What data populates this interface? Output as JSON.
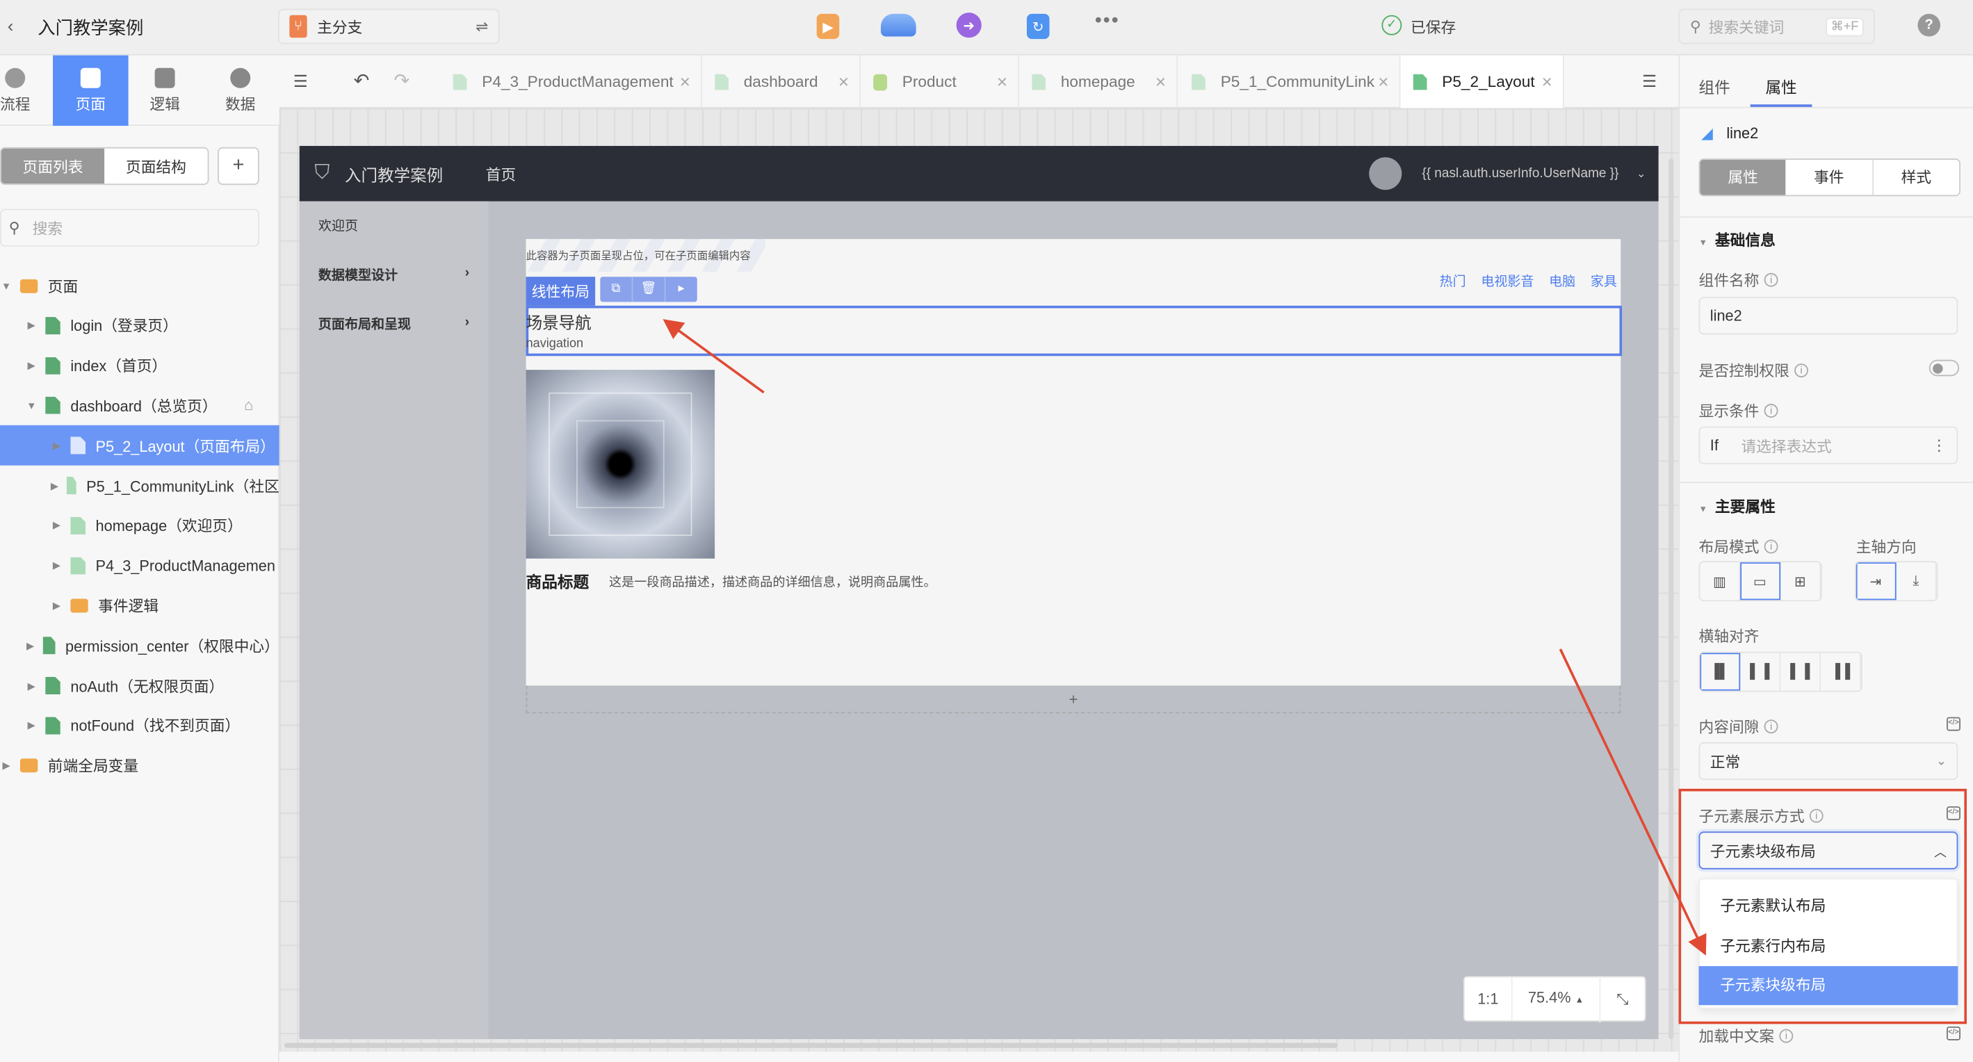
{
  "topbar": {
    "back_icon": "chevron-left-icon",
    "app_title": "入门教学案例",
    "branch": "主分支",
    "branch_switch_icon": "swap-icon",
    "tools": [
      "play-icon",
      "cloud-icon",
      "publish-icon",
      "sync-icon",
      "more-icon"
    ],
    "saved_status": "已保存",
    "search_placeholder": "搜索关键词",
    "search_shortcut": "⌘+F",
    "help_icon": "help-icon"
  },
  "strip": [
    {
      "label": "流程",
      "icon": "flow-icon"
    },
    {
      "label": "页面",
      "icon": "page-icon",
      "active": true
    },
    {
      "label": "逻辑",
      "icon": "chip-icon"
    },
    {
      "label": "数据",
      "icon": "pie-icon"
    }
  ],
  "leftpanel": {
    "seg": [
      "页面列表",
      "页面结构"
    ],
    "add": "+",
    "search_placeholder": "搜索",
    "tree": [
      {
        "label": "页面",
        "type": "folder",
        "depth": 0,
        "expanded": true
      },
      {
        "label": "login（登录页）",
        "type": "page",
        "depth": 1
      },
      {
        "label": "index（首页）",
        "type": "page",
        "depth": 1
      },
      {
        "label": "dashboard（总览页）",
        "type": "page",
        "depth": 1,
        "expanded": true,
        "home": true
      },
      {
        "label": "P5_2_Layout（页面布局）",
        "type": "subpage",
        "depth": 2,
        "selected": true
      },
      {
        "label": "P5_1_CommunityLink（社区",
        "type": "subpage",
        "depth": 2
      },
      {
        "label": "homepage（欢迎页）",
        "type": "subpage",
        "depth": 2
      },
      {
        "label": "P4_3_ProductManagemen",
        "type": "subpage",
        "depth": 2
      },
      {
        "label": "事件逻辑",
        "type": "folder",
        "depth": 2
      },
      {
        "label": "permission_center（权限中心）",
        "type": "page",
        "depth": 1
      },
      {
        "label": "noAuth（无权限页面）",
        "type": "page",
        "depth": 1
      },
      {
        "label": "notFound（找不到页面）",
        "type": "page",
        "depth": 1
      },
      {
        "label": "前端全局变量",
        "type": "folder",
        "depth": 0
      }
    ]
  },
  "tabs": [
    {
      "label": "P4_3_ProductManagement"
    },
    {
      "label": "dashboard"
    },
    {
      "label": "Product"
    },
    {
      "label": "homepage"
    },
    {
      "label": "P5_1_CommunityLink"
    },
    {
      "label": "P5_2_Layout",
      "active": true
    }
  ],
  "preview": {
    "app_title": "入门教学案例",
    "nav_home": "首页",
    "username": "{{ nasl.auth.userInfo.UserName }}",
    "menu": [
      "欢迎页",
      "数据模型设计",
      "页面布局和呈现"
    ],
    "placeholder_note": "此容器为子页面呈现占位，可在子页面编辑内容",
    "links": [
      "热门",
      "电视影音",
      "电脑",
      "家具"
    ],
    "selected_component_tag": "线性布局",
    "nav_title": "场景导航",
    "nav_sub": "navigation",
    "product_title": "商品标题",
    "product_desc": "这是一段商品描述，描述商品的详细信息，说明商品属性。",
    "add": "+"
  },
  "zoom": {
    "reset": "1:1",
    "level": "75.4%"
  },
  "rightpanel": {
    "tabs": [
      "组件",
      "属性"
    ],
    "active_tab": "属性",
    "component": "line2",
    "subtabs": [
      "属性",
      "事件",
      "样式"
    ],
    "section_basic": "基础信息",
    "name_label": "组件名称",
    "name_value": "line2",
    "perm_label": "是否控制权限",
    "perm_enabled": false,
    "cond_label": "显示条件",
    "cond_prefix": "If",
    "cond_placeholder": "请选择表达式",
    "section_main": "主要属性",
    "layout_mode": "布局模式",
    "main_axis": "主轴方向",
    "cross_align": "横轴对齐",
    "gap_label": "内容间隙",
    "gap_value": "正常",
    "child_label": "子元素展示方式",
    "child_value": "子元素块级布局",
    "child_options": [
      "子元素默认布局",
      "子元素行内布局",
      "子元素块级布局"
    ],
    "loading_label": "加载中文案"
  },
  "colors": {
    "accent": "#6b96f5",
    "annotation": "#e04a33",
    "preview_header": "#2b2e36"
  }
}
